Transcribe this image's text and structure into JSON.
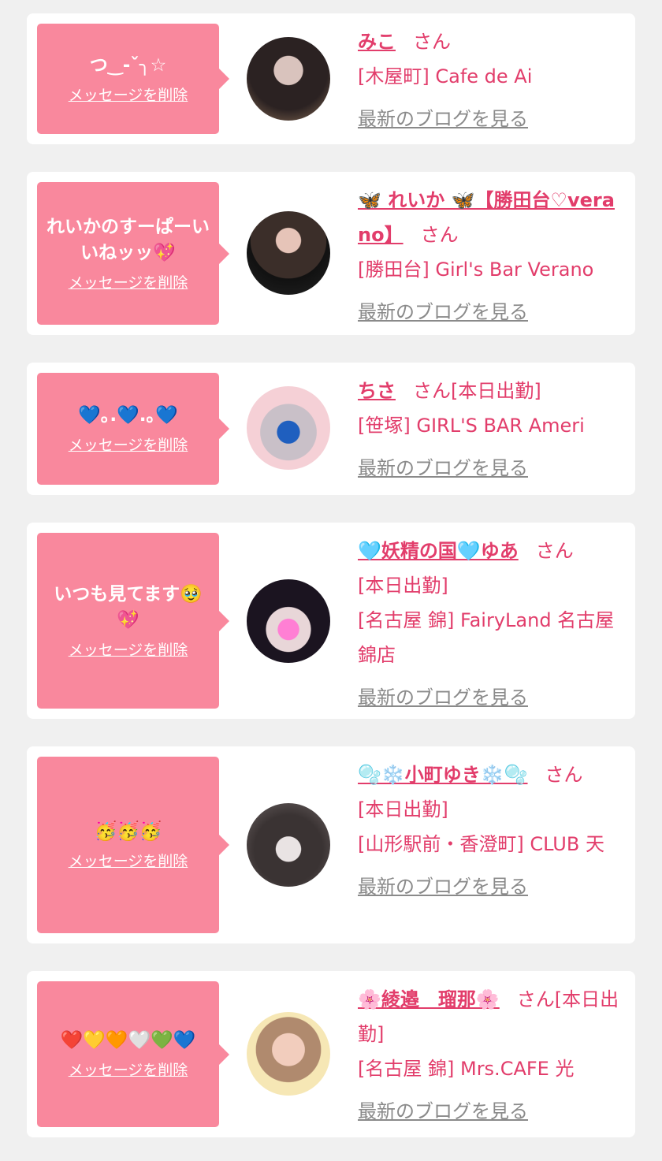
{
  "theme": {
    "bubble_color": "#f9889d",
    "accent_color": "#e23d6b",
    "link_gray": "#8a8a8a",
    "background": "#f0f0f0"
  },
  "common": {
    "delete_label": "メッセージを削除",
    "blog_label": "最新のブログを見る"
  },
  "cards": [
    {
      "message": "つ‿-ˇ╮☆",
      "name": "みこ",
      "san": "さん",
      "status": "",
      "shop": "[木屋町] Cafe de Ai",
      "avatar": "#3a3535"
    },
    {
      "message": "れいかのすーぱーいいねッッ💖",
      "name": "🦋 れいか 🦋【勝田台♡verano】",
      "san": "さん",
      "status": "",
      "shop": "[勝田台] Girl's Bar Verano",
      "avatar": "#4a3a34"
    },
    {
      "message": "💙｡.💙.｡💙",
      "name": "ちさ",
      "san": "さん",
      "status": "[本日出勤]",
      "shop": "[笹塚] GIRL'S BAR Ameri",
      "avatar": "#f3c9cf"
    },
    {
      "message": "いつも見てます🥹💖",
      "name": "🩵妖精の国🩵ゆあ",
      "san": "さん",
      "status": "[本日出勤]",
      "shop": "[名古屋 錦] FairyLand 名古屋錦店",
      "avatar": "#2a1e2a"
    },
    {
      "message": "🥳🥳🥳",
      "name": "🫧❄️小町ゆき❄️🫧",
      "san": "さん",
      "status": "[本日出勤]",
      "shop": "[山形駅前・香澄町] CLUB 天",
      "avatar": "#5b5656"
    },
    {
      "message": "❤️💛🧡🤍💚💙",
      "name": "🌸綾邉　瑠那🌸",
      "san": "さん",
      "status": "[本日出勤]",
      "shop": "[名古屋 錦] Mrs.CAFE 光",
      "avatar": "#f6e7b5"
    }
  ]
}
